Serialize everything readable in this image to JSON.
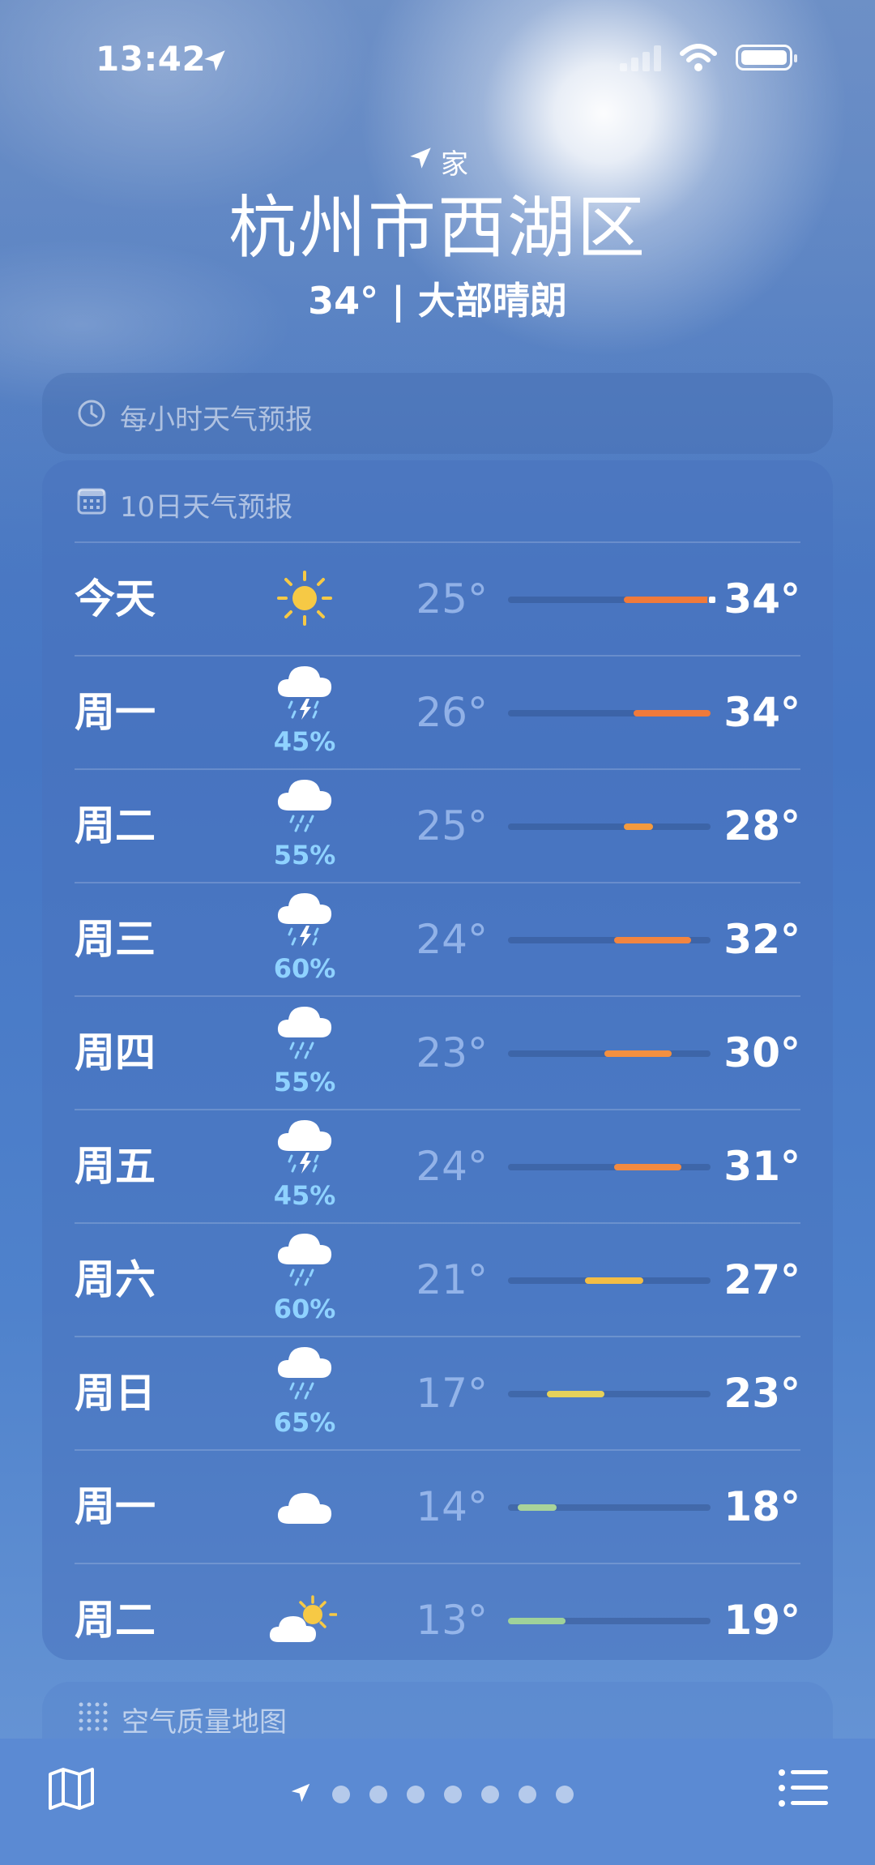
{
  "status_bar": {
    "time": "13:42"
  },
  "header": {
    "home_label": "家",
    "city": "杭州市西湖区",
    "summary": "34° | 大部晴朗"
  },
  "hourly_card": {
    "title": "每小时天气预报"
  },
  "daily_card": {
    "title": "10日天气预报",
    "days": [
      {
        "day": "今天",
        "icon": "sun-icon",
        "precip": "",
        "low": "25°",
        "high": "34°",
        "low_val": 25,
        "high_val": 34,
        "current": 34,
        "color": "#f07a3a"
      },
      {
        "day": "周一",
        "icon": "cloud-thunder-rain-icon",
        "precip": "45%",
        "low": "26°",
        "high": "34°",
        "low_val": 26,
        "high_val": 34,
        "color": "#f07a3a"
      },
      {
        "day": "周二",
        "icon": "cloud-rain-icon",
        "precip": "55%",
        "low": "25°",
        "high": "28°",
        "low_val": 25,
        "high_val": 28,
        "color": "#f39a3e"
      },
      {
        "day": "周三",
        "icon": "cloud-thunder-rain-icon",
        "precip": "60%",
        "low": "24°",
        "high": "32°",
        "low_val": 24,
        "high_val": 32,
        "color": "#f28540"
      },
      {
        "day": "周四",
        "icon": "cloud-rain-icon",
        "precip": "55%",
        "low": "23°",
        "high": "30°",
        "low_val": 23,
        "high_val": 30,
        "color": "#f39040"
      },
      {
        "day": "周五",
        "icon": "cloud-thunder-rain-icon",
        "precip": "45%",
        "low": "24°",
        "high": "31°",
        "low_val": 24,
        "high_val": 31,
        "color": "#f28a40"
      },
      {
        "day": "周六",
        "icon": "cloud-rain-icon",
        "precip": "60%",
        "low": "21°",
        "high": "27°",
        "low_val": 21,
        "high_val": 27,
        "color": "#f3bd45"
      },
      {
        "day": "周日",
        "icon": "cloud-rain-icon",
        "precip": "65%",
        "low": "17°",
        "high": "23°",
        "low_val": 17,
        "high_val": 23,
        "color": "#e6d15a"
      },
      {
        "day": "周一",
        "icon": "cloud-icon",
        "precip": "",
        "low": "14°",
        "high": "18°",
        "low_val": 14,
        "high_val": 18,
        "color": "#a9d39a"
      },
      {
        "day": "周二",
        "icon": "partly-sunny-icon",
        "precip": "",
        "low": "13°",
        "high": "19°",
        "low_val": 13,
        "high_val": 19,
        "color": "#9fd29a"
      }
    ],
    "range_min": 13,
    "range_max": 34
  },
  "air_quality_card": {
    "title": "空气质量地图"
  },
  "toolbar": {
    "page_count": 7
  }
}
